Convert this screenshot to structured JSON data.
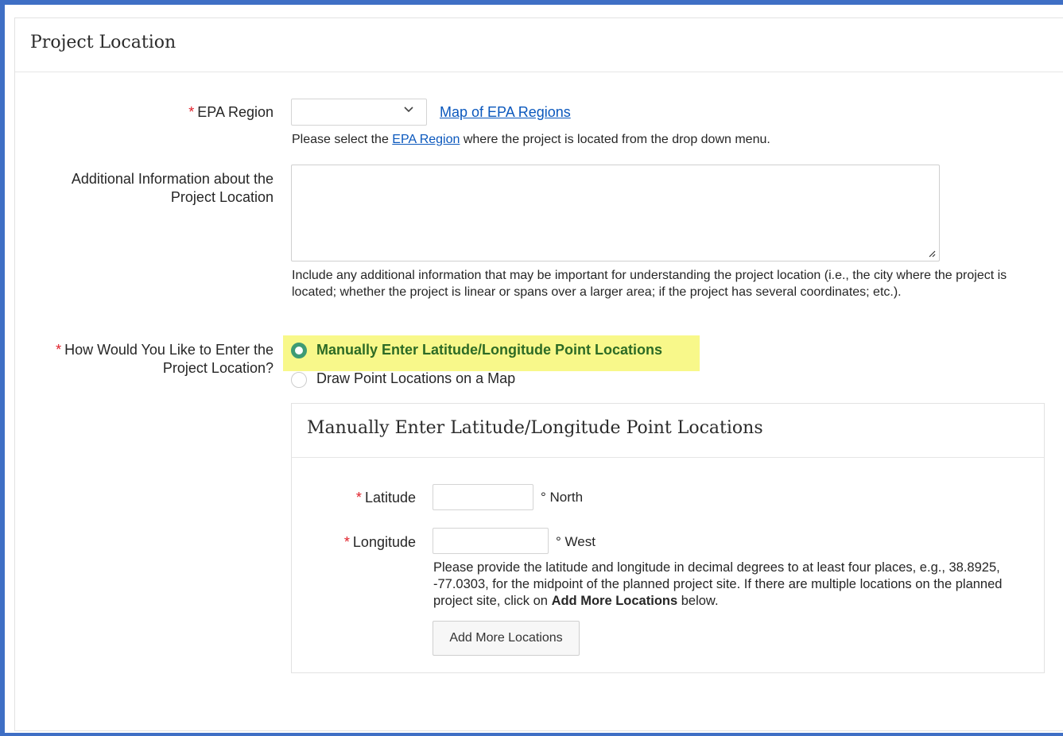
{
  "region": {
    "title": "Project Location"
  },
  "epa_region": {
    "required": "*",
    "label": "EPA Region",
    "selected_value": "",
    "map_link": "Map of EPA Regions",
    "help_before": "Please select the ",
    "help_link": "EPA Region",
    "help_after": " where the project is located from the drop down menu."
  },
  "additional_info": {
    "label": "Additional Information about the Project Location",
    "value": "",
    "help": "Include any additional information that may be important for understanding the project location (i.e., the city where the project is located; whether the project is linear or spans over a larger area; if the project has several coordinates; etc.)."
  },
  "entry_method": {
    "required": "*",
    "label": "How Would You Like to Enter the Project Location?",
    "options": [
      {
        "label": "Manually Enter Latitude/Longitude Point Locations",
        "selected": true
      },
      {
        "label": "Draw Point Locations on a Map",
        "selected": false
      }
    ]
  },
  "manual_entry": {
    "title": "Manually Enter Latitude/Longitude Point Locations",
    "latitude": {
      "required": "*",
      "label": "Latitude",
      "value": "",
      "unit": "° North"
    },
    "longitude": {
      "required": "*",
      "label": "Longitude",
      "value": "",
      "unit": "° West"
    },
    "help_text": "Please provide the latitude and longitude in decimal degrees to at least four places, e.g., 38.8925, -77.0303, for the midpoint of the planned project site. If there are multiple locations on the planned project site, click on ",
    "help_bold": "Add More Locations",
    "help_end": " below.",
    "add_button": "Add More Locations"
  },
  "colors": {
    "frame_border": "#3f6fc5",
    "required": "#e0202a",
    "link": "#0b58bd",
    "highlight": "#f8f88a",
    "selected_radio": "#3e9b74"
  }
}
